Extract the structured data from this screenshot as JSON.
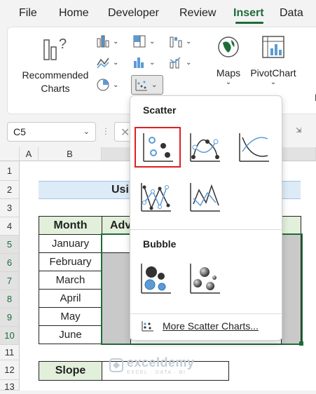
{
  "tabs": [
    "File",
    "Home",
    "Developer",
    "Review",
    "Insert",
    "Data"
  ],
  "active_tab": "Insert",
  "ribbon": {
    "recommended_charts_line1": "Recommended",
    "recommended_charts_line2": "Charts",
    "maps_label": "Maps",
    "pivotchart_label": "PivotChart",
    "truncated_label": "Pi"
  },
  "formula_bar": {
    "name_box": "C5"
  },
  "columns": [
    "A",
    "B"
  ],
  "rows": [
    "1",
    "2",
    "3",
    "4",
    "5",
    "6",
    "7",
    "8",
    "9",
    "10",
    "11",
    "12",
    "13"
  ],
  "sheet": {
    "title_visible": "Usi",
    "table_header_month": "Month",
    "table_header_adv": "Adv",
    "months": [
      "January",
      "February",
      "March",
      "April",
      "May",
      "June"
    ],
    "slope_label": "Slope"
  },
  "dropdown": {
    "scatter_title": "Scatter",
    "bubble_title": "Bubble",
    "more_label": "More Scatter Charts..."
  },
  "watermark": {
    "name": "exceldemy",
    "tagline": "EXCEL · DATA · BI"
  },
  "colors": {
    "accent_green": "#1e6b3a",
    "header_fill": "#e2efda",
    "selection_red": "#e02020",
    "chart_blue": "#5b9bd5"
  }
}
